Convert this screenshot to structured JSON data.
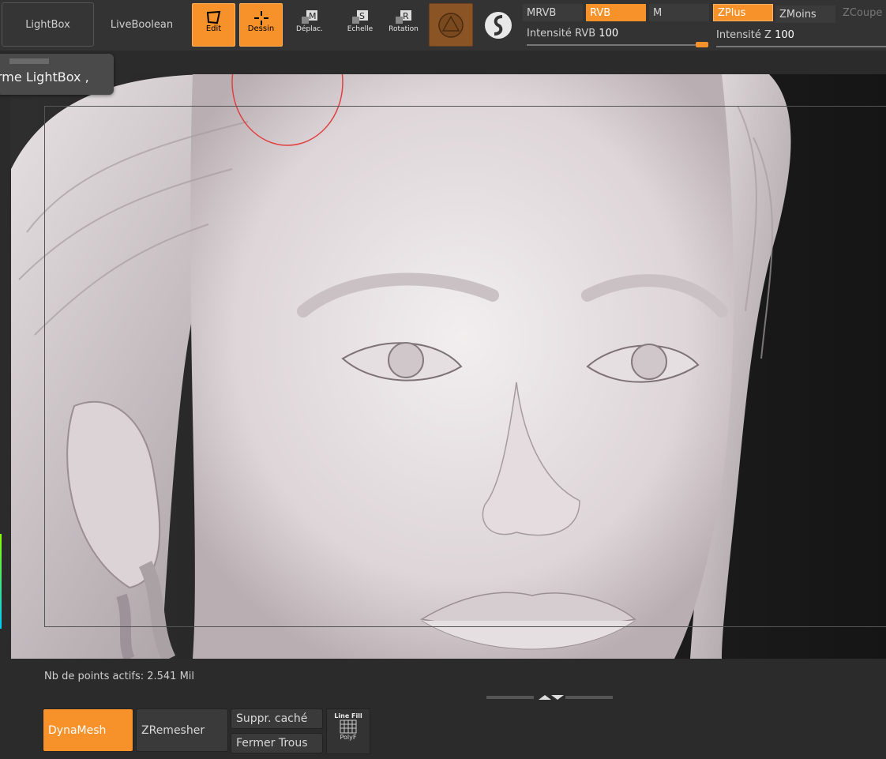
{
  "toolbar": {
    "lightbox": "LightBox",
    "liveboolean": "LiveBoolean",
    "edit": "Edit",
    "dessin": "Dessin",
    "deplac": "Déplac.",
    "echelle": "Echelle",
    "rotation": "Rotation",
    "mrvb": "MRVB",
    "rvb": "RVB",
    "m": "M",
    "zplus": "ZPlus",
    "zmoins": "ZMoins",
    "zcoupe": "ZCoupe",
    "rvb_intensity_label": "Intensité RVB",
    "rvb_intensity_value": "100",
    "z_intensity_label": "Intensité Z",
    "z_intensity_value": "100"
  },
  "tooltip": {
    "text": "rme LightBox ,"
  },
  "status": {
    "active_points": "Nb de points actifs: 2.541 Mil"
  },
  "bottom": {
    "dynamesh": "DynaMesh",
    "zremesher": "ZRemesher",
    "suppr_cache": "Suppr. caché",
    "fermer_trous": "Fermer Trous",
    "linefill_top": "Line Fill",
    "linefill_bottom": "PolyF"
  },
  "colors": {
    "accent": "#f7922a",
    "panel": "#333333",
    "viewport": "#1d1d1d"
  }
}
